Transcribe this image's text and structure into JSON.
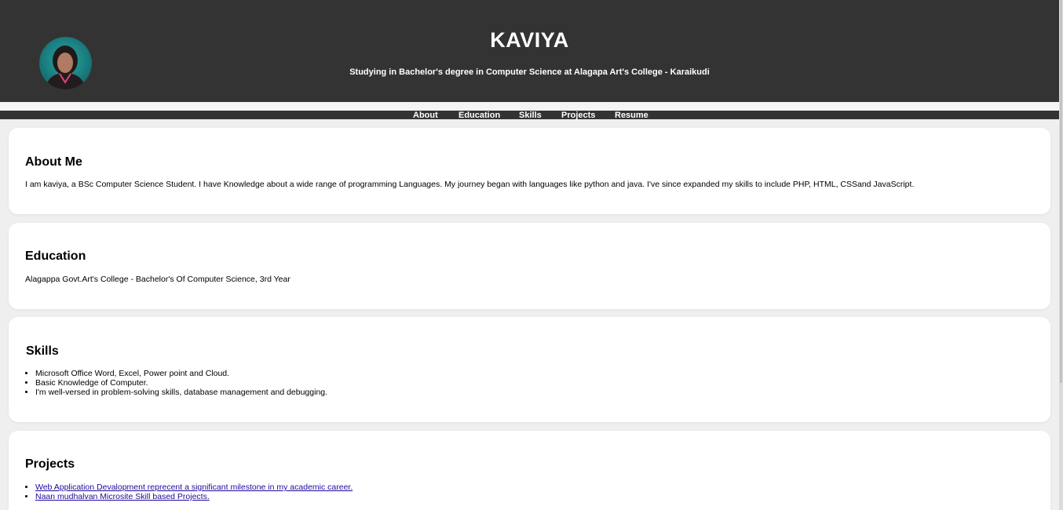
{
  "header": {
    "name": "KAVIYA",
    "tagline": "Studying in Bachelor's degree in Computer Science at Alagapa Art's College - Karaikudi"
  },
  "nav": {
    "items": [
      {
        "label": "About"
      },
      {
        "label": "Education"
      },
      {
        "label": "Skills"
      },
      {
        "label": "Projects"
      },
      {
        "label": "Resume"
      }
    ]
  },
  "about": {
    "title": "About Me",
    "text": "I am kaviya, a BSc Computer Science Student. I have Knowledge about a wide range of programming Languages. My journey began with languages like python and java. I've since expanded my skills to include PHP, HTML, CSSand JavaScript."
  },
  "education": {
    "title": "Education",
    "text": "Alagappa Govt.Art's College - Bachelor's Of Computer Science, 3rd Year"
  },
  "skills": {
    "title": "Skills",
    "items": [
      "Microsoft Office Word, Excel, Power point and Cloud.",
      "Basic Knowledge of Computer.",
      "I'm well-versed in problem-solving skills, database management and debugging."
    ]
  },
  "projects": {
    "title": "Projects",
    "items": [
      "Web Application Devalopment reprecent a significant milestone in my academic career.",
      "Naan mudhalvan Microsite Skill based Projects."
    ]
  },
  "colors": {
    "header_bg": "#333333",
    "page_bg": "#efefef",
    "card_bg": "#ffffff",
    "link": "#1c0a9b"
  }
}
